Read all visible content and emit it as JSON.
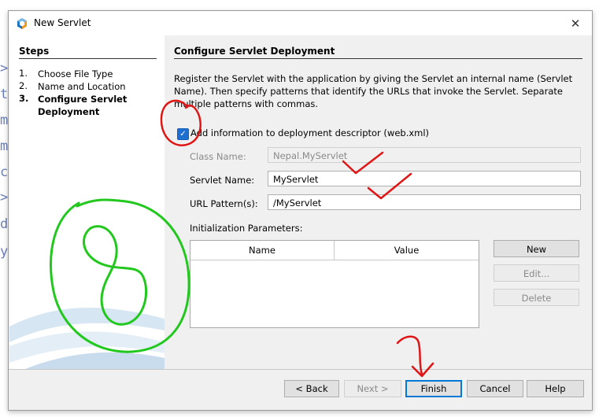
{
  "window": {
    "title": "New Servlet",
    "close_glyph": "✕"
  },
  "steps": {
    "title": "Steps",
    "items": [
      {
        "num": "1.",
        "label": "Choose File Type"
      },
      {
        "num": "2.",
        "label": "Name and Location"
      },
      {
        "num": "3.",
        "label": "Configure Servlet Deployment"
      }
    ]
  },
  "main": {
    "section_title": "Configure Servlet Deployment",
    "description": "Register the Servlet with the application by giving the Servlet an internal name (Servlet Name). Then specify patterns that identify the URLs that invoke the Servlet. Separate multiple patterns with commas.",
    "checkbox": {
      "label": "Add information to deployment descriptor (web.xml)",
      "checked": true,
      "glyph": "✓"
    },
    "class_name": {
      "label": "Class Name:",
      "value": "Nepal.MyServlet"
    },
    "servlet_name": {
      "label": "Servlet Name:",
      "value": "MyServlet"
    },
    "url_pattern": {
      "label": "URL Pattern(s):",
      "value": "/MyServlet"
    },
    "init_params": {
      "label": "Initialization Parameters:",
      "columns": [
        "Name",
        "Value"
      ],
      "rows": []
    },
    "side_buttons": {
      "new": "New",
      "edit": "Edit...",
      "delete": "Delete"
    }
  },
  "footer": {
    "back": "< Back",
    "next": "Next >",
    "finish": "Finish",
    "cancel": "Cancel",
    "help": "Help"
  },
  "background_code": [
    ">",
    "t",
    "m",
    "m",
    "c",
    ">",
    "d",
    "y"
  ],
  "annotation_colors": {
    "red": "#e01515",
    "green": "#22c81e"
  },
  "icons": {
    "app": "netbeans-logo-icon",
    "close": "close-icon",
    "check": "checkmark-icon"
  }
}
